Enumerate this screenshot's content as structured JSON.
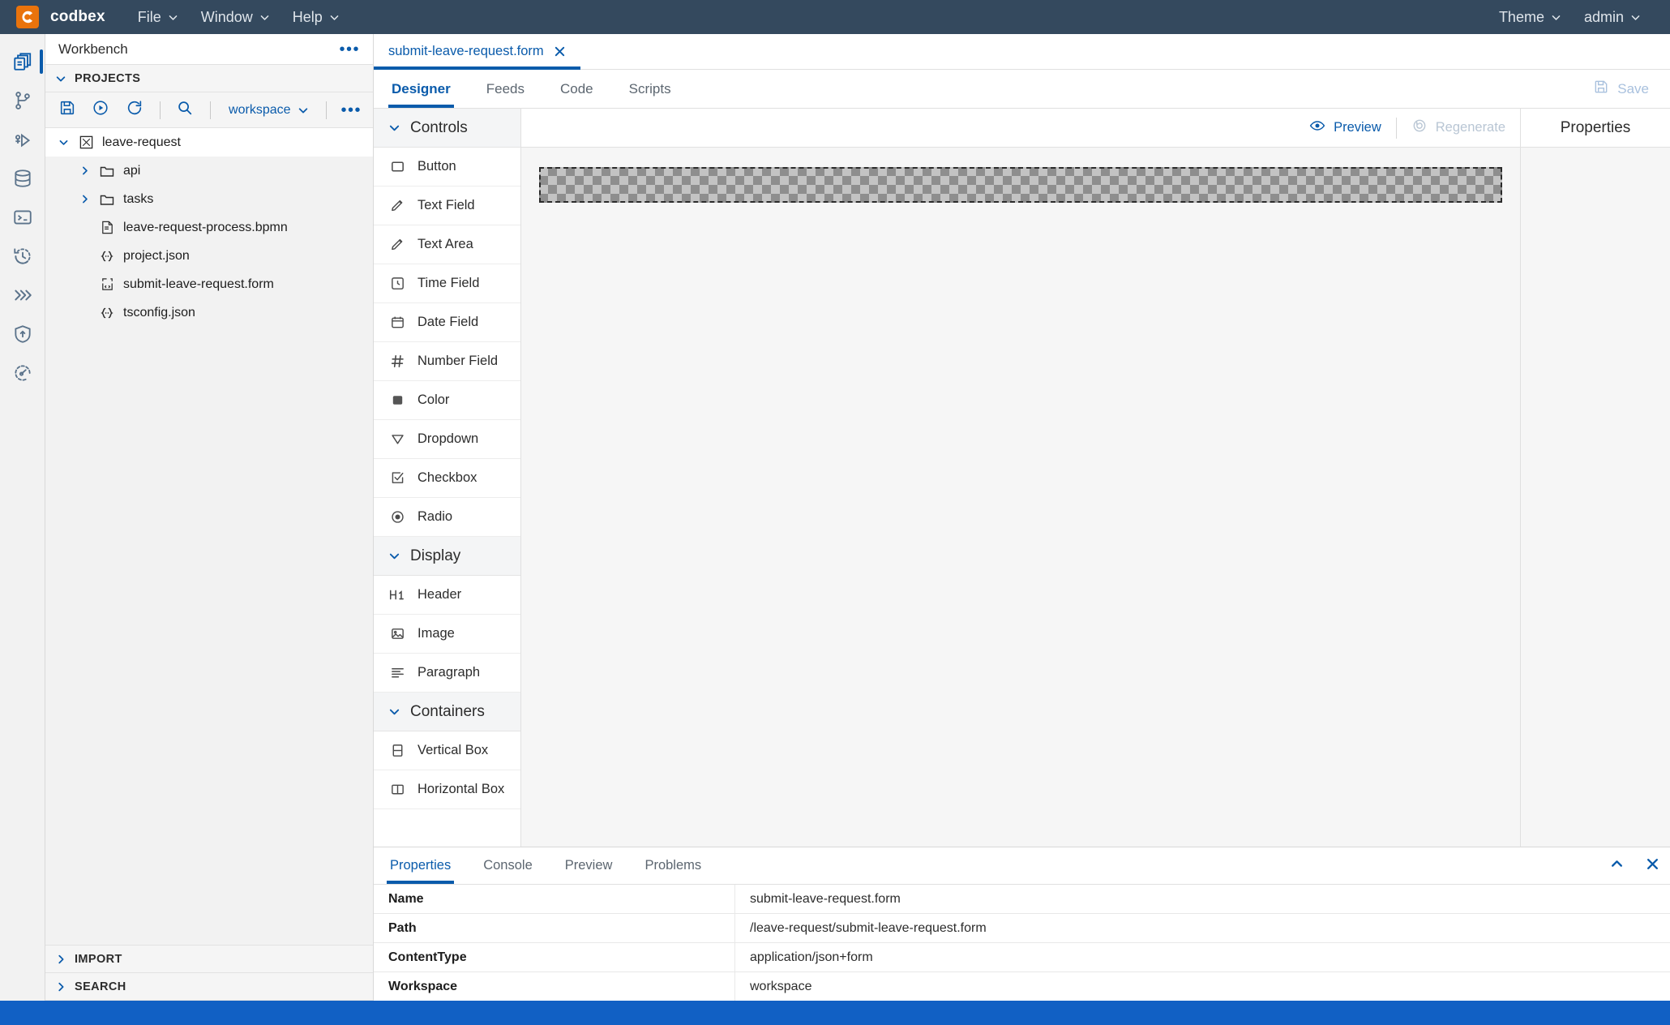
{
  "topbar": {
    "brand": "codbex",
    "menus": [
      {
        "label": "File",
        "icon": "chevron-down-icon"
      },
      {
        "label": "Window",
        "icon": "chevron-down-icon"
      },
      {
        "label": "Help",
        "icon": "chevron-down-icon"
      }
    ],
    "right": [
      {
        "label": "Theme",
        "icon": "chevron-down-icon"
      },
      {
        "label": "admin",
        "icon": "chevron-down-icon"
      }
    ]
  },
  "rail": {
    "items": [
      {
        "name": "workbench-icon",
        "active": true
      },
      {
        "name": "git-branch-icon",
        "active": false
      },
      {
        "name": "debugger-icon",
        "active": false
      },
      {
        "name": "database-icon",
        "active": false
      },
      {
        "name": "terminal-icon",
        "active": false
      },
      {
        "name": "history-icon",
        "active": false
      },
      {
        "name": "flow-icon",
        "active": false
      },
      {
        "name": "security-shield-icon",
        "active": false
      },
      {
        "name": "gauge-icon",
        "active": false
      }
    ]
  },
  "explorer": {
    "title": "Workbench",
    "more_label": "•••",
    "projects_section": "PROJECTS",
    "toolbar": {
      "save_icon": "save-icon",
      "run_icon": "run-icon",
      "refresh_icon": "refresh-icon",
      "search_icon": "search-icon",
      "workspace_label": "workspace",
      "more_label": "•••"
    },
    "tree": [
      {
        "label": "leave-request",
        "icon": "project-icon",
        "depth": 0,
        "twisty": "down",
        "root": true
      },
      {
        "label": "api",
        "icon": "folder-icon",
        "depth": 1,
        "twisty": "right",
        "root": false
      },
      {
        "label": "tasks",
        "icon": "folder-icon",
        "depth": 1,
        "twisty": "right",
        "root": false
      },
      {
        "label": "leave-request-process.bpmn",
        "icon": "bpmn-file-icon",
        "depth": 1,
        "twisty": "none",
        "root": false
      },
      {
        "label": "project.json",
        "icon": "json-file-icon",
        "depth": 1,
        "twisty": "none",
        "root": false
      },
      {
        "label": "submit-leave-request.form",
        "icon": "form-file-icon",
        "depth": 1,
        "twisty": "none",
        "root": false
      },
      {
        "label": "tsconfig.json",
        "icon": "json-file-icon",
        "depth": 1,
        "twisty": "none",
        "root": false
      }
    ],
    "bottom_sections": [
      {
        "label": "IMPORT"
      },
      {
        "label": "SEARCH"
      }
    ]
  },
  "editor": {
    "tab": {
      "label": "submit-leave-request.form",
      "close_icon": "close-icon"
    },
    "subtabs": [
      {
        "label": "Designer",
        "active": true
      },
      {
        "label": "Feeds",
        "active": false
      },
      {
        "label": "Code",
        "active": false
      },
      {
        "label": "Scripts",
        "active": false
      }
    ],
    "save": {
      "label": "Save",
      "icon": "save-icon",
      "disabled": true
    }
  },
  "palette": {
    "groups": [
      {
        "label": "Controls",
        "items": [
          {
            "label": "Button",
            "icon": "button-icon"
          },
          {
            "label": "Text Field",
            "icon": "pencil-icon"
          },
          {
            "label": "Text Area",
            "icon": "pencil-icon"
          },
          {
            "label": "Time Field",
            "icon": "clock-icon"
          },
          {
            "label": "Date Field",
            "icon": "calendar-icon"
          },
          {
            "label": "Number Field",
            "icon": "hash-icon"
          },
          {
            "label": "Color",
            "icon": "color-swatch-icon"
          },
          {
            "label": "Dropdown",
            "icon": "dropdown-triangle-icon"
          },
          {
            "label": "Checkbox",
            "icon": "checkbox-icon"
          },
          {
            "label": "Radio",
            "icon": "radio-icon"
          }
        ]
      },
      {
        "label": "Display",
        "items": [
          {
            "label": "Header",
            "icon": "h1-icon"
          },
          {
            "label": "Image",
            "icon": "image-icon"
          },
          {
            "label": "Paragraph",
            "icon": "paragraph-icon"
          }
        ]
      },
      {
        "label": "Containers",
        "items": [
          {
            "label": "Vertical Box",
            "icon": "vertical-box-icon"
          },
          {
            "label": "Horizontal Box",
            "icon": "horizontal-box-icon"
          }
        ]
      }
    ]
  },
  "canvas": {
    "toolbar": {
      "preview": {
        "label": "Preview",
        "icon": "eye-icon",
        "disabled": false
      },
      "regenerate": {
        "label": "Regenerate",
        "icon": "regenerate-icon",
        "disabled": true
      },
      "properties": {
        "label": "Properties"
      }
    },
    "dropzone": {
      "name": "form-dropzone",
      "empty": true
    }
  },
  "bottom_panel": {
    "tabs": [
      {
        "label": "Properties",
        "active": true
      },
      {
        "label": "Console",
        "active": false
      },
      {
        "label": "Preview",
        "active": false
      },
      {
        "label": "Problems",
        "active": false
      }
    ],
    "collapse_icon": "chevron-up-icon",
    "close_icon": "close-icon",
    "rows": [
      {
        "key": "Name",
        "value": "submit-leave-request.form"
      },
      {
        "key": "Path",
        "value": "/leave-request/submit-leave-request.form"
      },
      {
        "key": "ContentType",
        "value": "application/json+form"
      },
      {
        "key": "Workspace",
        "value": "workspace"
      }
    ]
  },
  "colors": {
    "topbar_bg": "#34495e",
    "accent": "#0a5bab",
    "brand_orange": "#e9730c",
    "statusbar": "#1160c4",
    "panel_bg": "#f2f2f2"
  }
}
